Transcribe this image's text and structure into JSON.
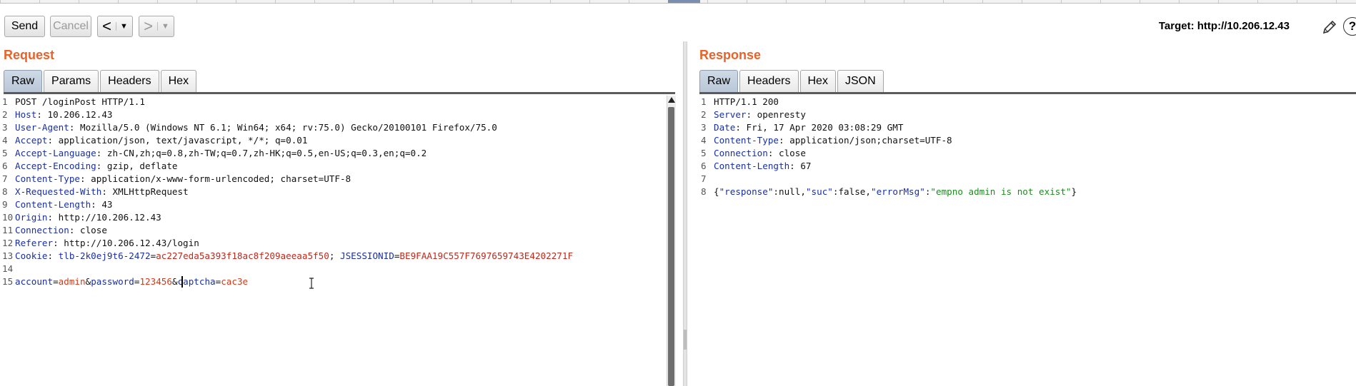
{
  "toolbar": {
    "send_label": "Send",
    "cancel_label": "Cancel",
    "back_arrow": "<",
    "forward_arrow": ">",
    "dropdown_glyph": "▼",
    "target_label": "Target: http://10.206.12.43",
    "help_glyph": "?"
  },
  "request": {
    "title": "Request",
    "tabs": [
      "Raw",
      "Params",
      "Headers",
      "Hex"
    ],
    "active_tab": "Raw",
    "lines": {
      "n1": "1",
      "n2": "2",
      "n3": "3",
      "n4": "4",
      "n5": "5",
      "n6": "6",
      "n7": "7",
      "n8": "8",
      "n9": "9",
      "n10": "10",
      "n11": "11",
      "n12": "12",
      "n13": "13",
      "n14": "14",
      "n15": "15",
      "l1": "POST /loginPost HTTP/1.1",
      "h2": "Host",
      "v2": " 10.206.12.43",
      "h3": "User-Agent",
      "v3": " Mozilla/5.0 (Windows NT 6.1; Win64; x64; rv:75.0) Gecko/20100101 Firefox/75.0",
      "h4": "Accept",
      "v4": " application/json, text/javascript, */*; q=0.01",
      "h5": "Accept-Language",
      "v5": " zh-CN,zh;q=0.8,zh-TW;q=0.7,zh-HK;q=0.5,en-US;q=0.3,en;q=0.2",
      "h6": "Accept-Encoding",
      "v6": " gzip, deflate",
      "h7": "Content-Type",
      "v7": " application/x-www-form-urlencoded; charset=UTF-8",
      "h8": "X-Requested-With",
      "v8": " XMLHttpRequest",
      "h9": "Content-Length",
      "v9": " 43",
      "h10": "Origin",
      "v10": " http://10.206.12.43",
      "h11": "Connection",
      "v11": " close",
      "h12": "Referer",
      "v12": " http://10.206.12.43/login",
      "h13": "Cookie",
      "c1k": "tlb-2k0ej9t6-2472",
      "c1v": "ac227eda5a393f18ac8f209aeeaa5f50",
      "c2k": "JSESSIONID",
      "c2v": "BE9FAA19C557F7697659743E4202271F",
      "p1k": "account",
      "p1v": "admin",
      "p2k": "password",
      "p2v": "123456",
      "p3k": "captcha",
      "p3v": "cac3e"
    }
  },
  "response": {
    "title": "Response",
    "tabs": [
      "Raw",
      "Headers",
      "Hex",
      "JSON"
    ],
    "active_tab": "Raw",
    "lines": {
      "n1": "1",
      "n2": "2",
      "n3": "3",
      "n4": "4",
      "n5": "5",
      "n6": "6",
      "n7": "7",
      "n8": "8",
      "l1": "HTTP/1.1 200",
      "h2": "Server",
      "v2": " openresty",
      "h3": "Date",
      "v3": " Fri, 17 Apr 2020 03:08:29 GMT",
      "h4": "Content-Type",
      "v4": " application/json;charset=UTF-8",
      "h5": "Connection",
      "v5": " close",
      "h6": "Content-Length",
      "v6": " 67",
      "j_k1": "\"response\"",
      "j_v1": "null",
      "j_k2": "\"suc\"",
      "j_v2": "false",
      "j_k3": "\"errorMsg\"",
      "j_v3": "\"empno admin is not exist\""
    }
  },
  "colors": {
    "title_orange": "#e8622a",
    "header_name_blue": "#1a2fa0",
    "param_value_red": "#d13a1a",
    "json_string_green": "#1f8a1f"
  },
  "icons": [
    "pencil-icon",
    "help-icon",
    "scroll-up-icon",
    "text-cursor-icon"
  ]
}
